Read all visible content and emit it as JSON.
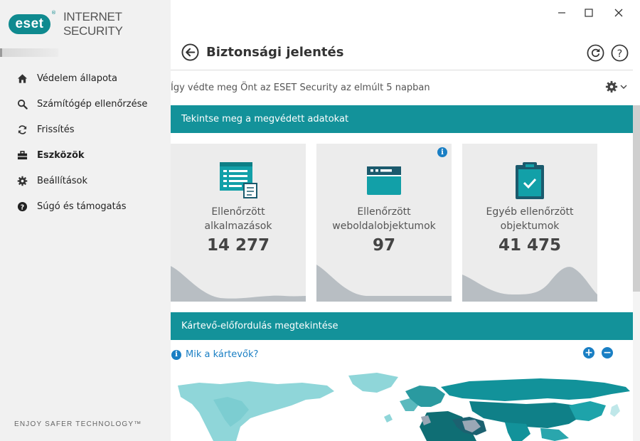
{
  "app": {
    "logo_text": "eset",
    "logo_reg": "®",
    "product_name": "INTERNET SECURITY",
    "slogan": "ENJOY SAFER TECHNOLOGY™",
    "accent_color": "#13929a"
  },
  "window_controls": {
    "minimize": "—",
    "maximize": "☐",
    "close": "✕"
  },
  "sidebar": {
    "items": [
      {
        "label": "Védelem állapota",
        "icon": "home-icon"
      },
      {
        "label": "Számítógép ellenőrzése",
        "icon": "search-icon"
      },
      {
        "label": "Frissítés",
        "icon": "refresh-icon"
      },
      {
        "label": "Eszközök",
        "icon": "toolbox-icon",
        "active": true
      },
      {
        "label": "Beállítások",
        "icon": "gear-icon"
      },
      {
        "label": "Súgó és támogatás",
        "icon": "help-icon"
      }
    ]
  },
  "header": {
    "title": "Biztonsági jelentés",
    "subtitle": "Így védte meg Önt az ESET Security az elmúlt 5 napban"
  },
  "protected_section": {
    "title": "Tekintse meg a megvédett adatokat",
    "cards": [
      {
        "label_line1": "Ellenőrzött",
        "label_line2": "alkalmazások",
        "value": "14 277",
        "icon": "application-list-icon"
      },
      {
        "label_line1": "Ellenőrzött",
        "label_line2": "weboldalobjektumok",
        "value": "97",
        "icon": "browser-window-icon"
      },
      {
        "label_line1": "Egyéb ellenőrzött",
        "label_line2": "objektumok",
        "value": "41 475",
        "icon": "clipboard-check-icon"
      }
    ],
    "info_badge": "i"
  },
  "malware_section": {
    "title": "Kártevő-előfordulás megtekintése",
    "link": "Mik a kártevők?",
    "info_badge": "i",
    "zoom_in": "+",
    "zoom_out": "−"
  }
}
